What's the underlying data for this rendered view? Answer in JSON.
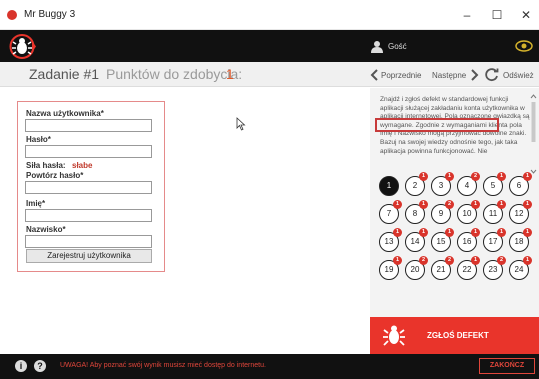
{
  "window": {
    "title": "Mr Buggy 3",
    "minimize": "–",
    "maximize": "☐",
    "close": "✕"
  },
  "user": {
    "name": "Gość"
  },
  "header": {
    "task_title": "Zadanie #1",
    "points_label": "Punktów do zdobycia:",
    "points_value": "1",
    "prev_label": "Poprzednie",
    "next_label": "Następne",
    "refresh_label": "Odśwież"
  },
  "form": {
    "username_label": "Nazwa użytkownika*",
    "username_value": "",
    "password_label": "Hasło*",
    "password_value": "",
    "strength_label": "Siła hasła:",
    "strength_value": "słabe",
    "repeat_label": "Powtórz hasło*",
    "repeat_value": "",
    "firstname_label": "Imię*",
    "firstname_value": "",
    "lastname_label": "Nazwisko*",
    "lastname_value": "",
    "register_button": "Zarejestruj użytkownika"
  },
  "description": {
    "part1": "Znajdź i zgłoś defekt w standardowej funkcji aplikacji służącej zakładaniu konta użytkownika w aplikacji internetowej.",
    "highlight": "Pola oznaczone gwiazdką są wymagane.",
    "part2": "Zgodnie z wymaganiami klienta pola Imię i Nazwisko mogą przyjmować dowolne znaki. Bazuj na swojej wiedzy odnośnie tego, jak taka aplikacja powinna funkcjonować. Nie"
  },
  "bugs": [
    {
      "number": "1",
      "badge": ""
    },
    {
      "number": "2",
      "badge": "1"
    },
    {
      "number": "3",
      "badge": "1"
    },
    {
      "number": "4",
      "badge": "2"
    },
    {
      "number": "5",
      "badge": "1"
    },
    {
      "number": "6",
      "badge": "1"
    },
    {
      "number": "7",
      "badge": "1"
    },
    {
      "number": "8",
      "badge": "1"
    },
    {
      "number": "9",
      "badge": "2"
    },
    {
      "number": "10",
      "badge": "1"
    },
    {
      "number": "11",
      "badge": "1"
    },
    {
      "number": "12",
      "badge": "1"
    },
    {
      "number": "13",
      "badge": "1"
    },
    {
      "number": "14",
      "badge": "1"
    },
    {
      "number": "15",
      "badge": "1"
    },
    {
      "number": "16",
      "badge": "1"
    },
    {
      "number": "17",
      "badge": "1"
    },
    {
      "number": "18",
      "badge": "1"
    },
    {
      "number": "19",
      "badge": "1"
    },
    {
      "number": "20",
      "badge": "2"
    },
    {
      "number": "21",
      "badge": "2"
    },
    {
      "number": "22",
      "badge": "1"
    },
    {
      "number": "23",
      "badge": "2"
    },
    {
      "number": "24",
      "badge": "1"
    }
  ],
  "report_button": "ZGŁOŚ DEFEKT",
  "footer": {
    "info_icon": "i",
    "help_icon": "?",
    "warning": "UWAGA! Aby poznać swój wynik musisz mieć dostęp do internetu.",
    "end_button": "ZAKOŃCZ"
  },
  "colors": {
    "accent": "#e9342b",
    "dark": "#111111",
    "points": "#e05a2b"
  }
}
